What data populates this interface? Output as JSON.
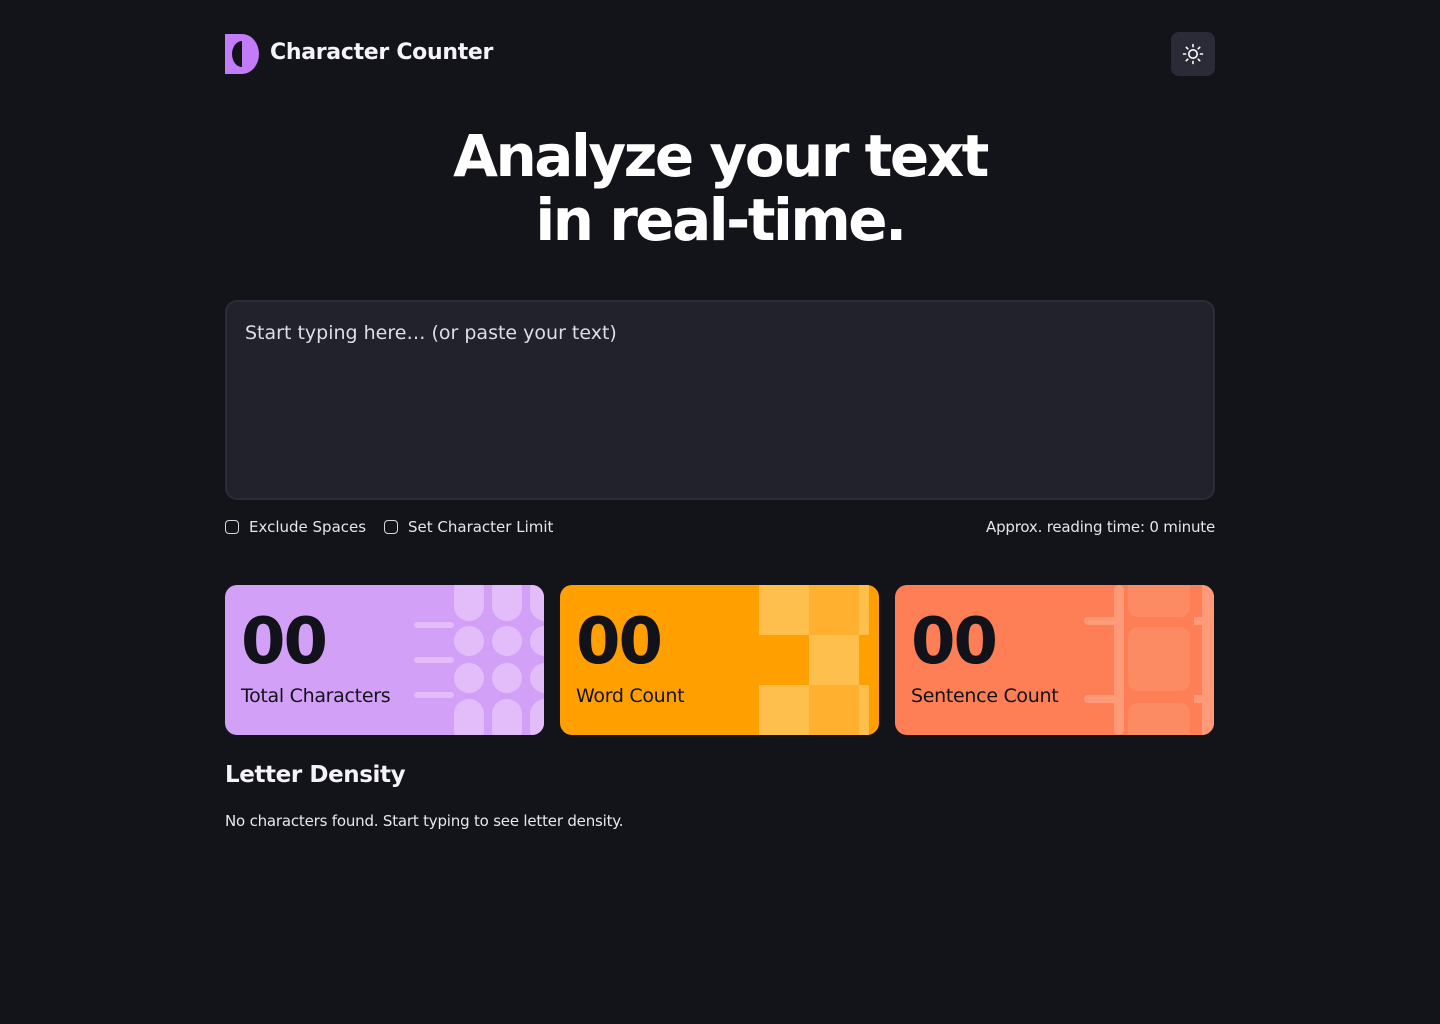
{
  "header": {
    "brand": "Character Counter",
    "theme_toggle_icon": "sun-icon"
  },
  "hero": {
    "line1": "Analyze your text",
    "line2": "in real-time."
  },
  "editor": {
    "placeholder": "Start typing here… (or paste your text)",
    "value": ""
  },
  "options": {
    "exclude_spaces": {
      "label": "Exclude Spaces",
      "checked": false
    },
    "char_limit": {
      "label": "Set Character Limit",
      "checked": false
    },
    "reading_time": "Approx. reading time: 0 minute"
  },
  "stats": {
    "total_characters": {
      "value": "00",
      "label": "Total Characters",
      "color": "#d3a0f7"
    },
    "word_count": {
      "value": "00",
      "label": "Word Count",
      "color": "#ffa000"
    },
    "sentence_count": {
      "value": "00",
      "label": "Sentence Count",
      "color": "#fe7f55"
    }
  },
  "letter_density": {
    "title": "Letter Density",
    "empty_message": "No characters found. Start typing to see letter density."
  },
  "colors": {
    "background": "#13131a",
    "surface": "#21222c",
    "accent_purple": "#c27cf8"
  }
}
